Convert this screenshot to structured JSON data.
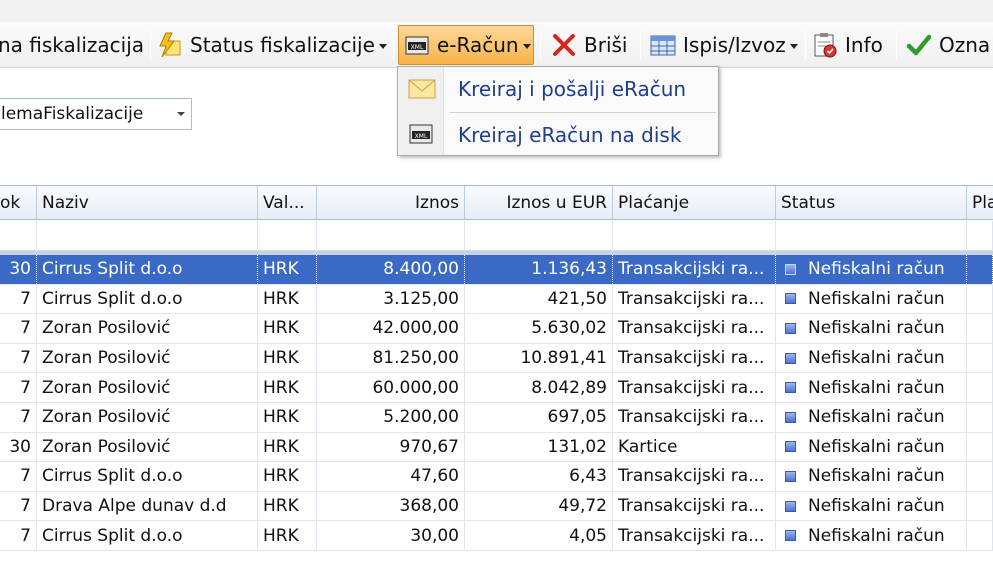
{
  "toolbar": {
    "items": [
      {
        "label": "na fiskalizacija",
        "icon": "none"
      },
      {
        "label": "Status fiskalizacije",
        "icon": "lightning-icon"
      },
      {
        "label": "e-Račun",
        "icon": "xml-icon"
      },
      {
        "label": "Briši",
        "icon": "delete-x-icon"
      },
      {
        "label": "Ispis/Izvoz",
        "icon": "table-icon"
      },
      {
        "label": "Info",
        "icon": "info-clipboard-icon"
      },
      {
        "label": "Ozna",
        "icon": "checkmark-icon"
      }
    ]
  },
  "menu": {
    "items": [
      {
        "label": "Kreiraj i pošalji eRačun",
        "icon": "envelope-icon"
      },
      {
        "label": "Kreiraj eRačun na disk",
        "icon": "xml-disk-icon"
      }
    ]
  },
  "filter": {
    "combo_value": "lemaFiskalizacije"
  },
  "grid": {
    "columns": [
      "ok",
      "Naziv",
      "Val...",
      "Iznos",
      "Iznos u EUR",
      "Plaćanje",
      "Status",
      "Pla"
    ],
    "rows": [
      {
        "rok": "30",
        "naziv": "Cirrus Split d.o.o",
        "valuta": "HRK",
        "iznos": "8.400,00",
        "iznos_eur": "1.136,43",
        "placanje": "Transakcijski ra...",
        "status": "Nefiskalni račun",
        "selected": true
      },
      {
        "rok": "7",
        "naziv": "Cirrus Split d.o.o",
        "valuta": "HRK",
        "iznos": "3.125,00",
        "iznos_eur": "421,50",
        "placanje": "Transakcijski ra...",
        "status": "Nefiskalni račun"
      },
      {
        "rok": "7",
        "naziv": "Zoran Posilović",
        "valuta": "HRK",
        "iznos": "42.000,00",
        "iznos_eur": "5.630,02",
        "placanje": "Transakcijski ra...",
        "status": "Nefiskalni račun"
      },
      {
        "rok": "7",
        "naziv": "Zoran Posilović",
        "valuta": "HRK",
        "iznos": "81.250,00",
        "iznos_eur": "10.891,41",
        "placanje": "Transakcijski ra...",
        "status": "Nefiskalni račun"
      },
      {
        "rok": "7",
        "naziv": "Zoran Posilović",
        "valuta": "HRK",
        "iznos": "60.000,00",
        "iznos_eur": "8.042,89",
        "placanje": "Transakcijski ra...",
        "status": "Nefiskalni račun"
      },
      {
        "rok": "7",
        "naziv": "Zoran Posilović",
        "valuta": "HRK",
        "iznos": "5.200,00",
        "iznos_eur": "697,05",
        "placanje": "Transakcijski ra...",
        "status": "Nefiskalni račun"
      },
      {
        "rok": "30",
        "naziv": "Zoran Posilović",
        "valuta": "HRK",
        "iznos": "970,67",
        "iznos_eur": "131,02",
        "placanje": "Kartice",
        "status": "Nefiskalni račun"
      },
      {
        "rok": "7",
        "naziv": "Cirrus Split d.o.o",
        "valuta": "HRK",
        "iznos": "47,60",
        "iznos_eur": "6,43",
        "placanje": "Transakcijski ra...",
        "status": "Nefiskalni račun"
      },
      {
        "rok": "7",
        "naziv": "Drava Alpe dunav d.d",
        "valuta": "HRK",
        "iznos": "368,00",
        "iznos_eur": "49,72",
        "placanje": "Transakcijski ra...",
        "status": "Nefiskalni račun"
      },
      {
        "rok": "7",
        "naziv": "Cirrus Split d.o.o",
        "valuta": "HRK",
        "iznos": "30,00",
        "iznos_eur": "4,05",
        "placanje": "Transakcijski ra...",
        "status": "Nefiskalni račun"
      }
    ]
  },
  "colors": {
    "selected_row": "#3a69c6",
    "menu_text": "#1f3e8c",
    "active_button": "#f7b349",
    "status_square": "#4e70d6"
  }
}
